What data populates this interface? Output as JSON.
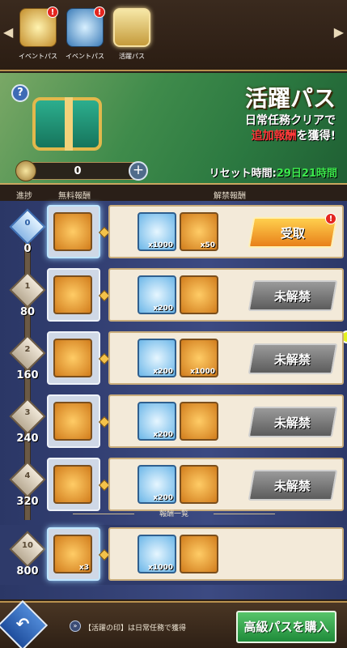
{
  "tabs": [
    {
      "label": "イベントパス",
      "style": "gold",
      "alert": "!"
    },
    {
      "label": "イベントパス",
      "style": "blue",
      "alert": "!"
    },
    {
      "label": "活躍パス",
      "style": "active",
      "alert": ""
    }
  ],
  "banner": {
    "title": "活躍パス",
    "subtitle_line1": "日常任務クリアで",
    "subtitle_red": "追加報酬",
    "subtitle_line2": "を獲得!",
    "counter_value": "0",
    "reset_label": "リセット時間:",
    "reset_time": "29日21時間"
  },
  "columns": {
    "progress": "進捗",
    "free": "無料報酬",
    "paid": "解禁報酬"
  },
  "rows": [
    {
      "level": "0",
      "points": "0",
      "free_qty": "",
      "paid1_qty": "x1000",
      "paid2_qty": "x50",
      "button": "受取",
      "state": "claim",
      "alert": "!"
    },
    {
      "level": "1",
      "points": "80",
      "free_qty": "",
      "paid1_qty": "x200",
      "paid2_qty": "",
      "button": "未解禁",
      "state": "locked",
      "alert": ""
    },
    {
      "level": "2",
      "points": "160",
      "free_qty": "",
      "paid1_qty": "x200",
      "paid2_qty": "x1000",
      "button": "未解禁",
      "state": "locked",
      "alert": ""
    },
    {
      "level": "3",
      "points": "240",
      "free_qty": "",
      "paid1_qty": "x200",
      "paid2_qty": "",
      "button": "未解禁",
      "state": "locked",
      "alert": ""
    },
    {
      "level": "4",
      "points": "320",
      "free_qty": "",
      "paid1_qty": "x200",
      "paid2_qty": "",
      "button": "未解禁",
      "state": "locked",
      "alert": ""
    }
  ],
  "divider_label": "報酬一覧",
  "final_row": {
    "level": "10",
    "points": "800",
    "free_qty": "x3",
    "paid1_qty": "x1000",
    "paid2_qty": ""
  },
  "footer": {
    "hint": "【活躍の印】は日常任務で獲得",
    "buy_label": "高級パスを購入"
  }
}
